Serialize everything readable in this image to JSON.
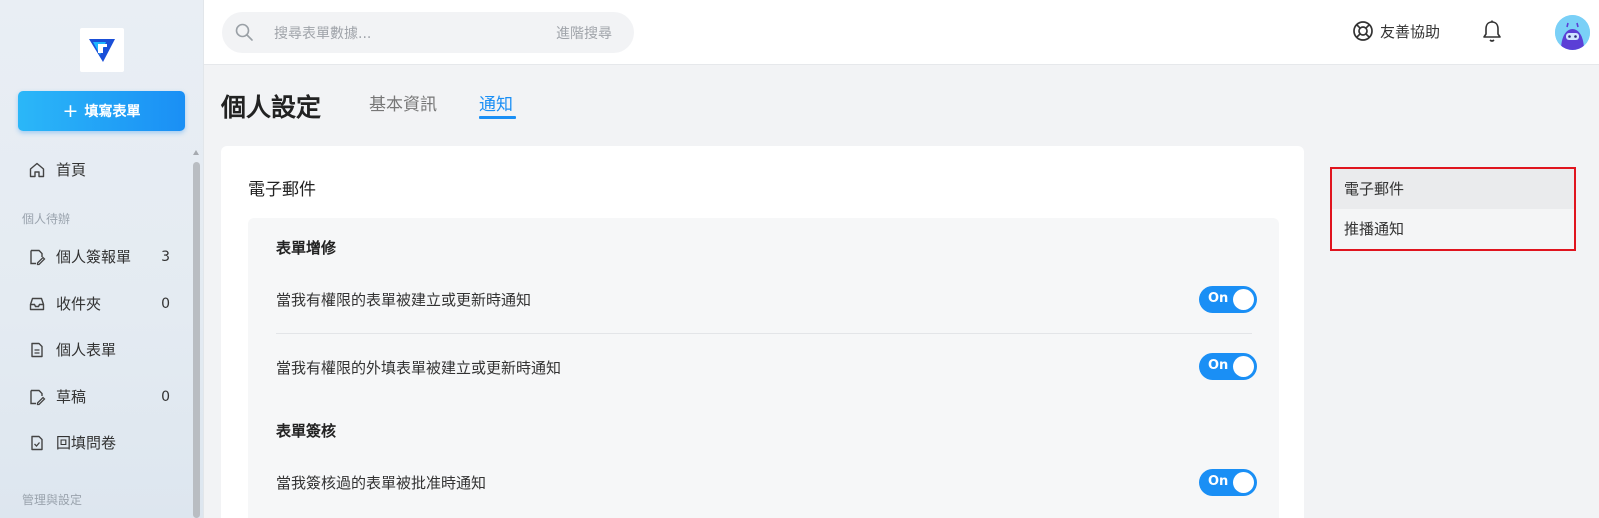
{
  "sidebar": {
    "fill_button": "填寫表單",
    "home": "首頁",
    "section_personal": "個人待辦",
    "items": [
      {
        "label": "個人簽報單",
        "count": "3"
      },
      {
        "label": "收件夾",
        "count": "0"
      },
      {
        "label": "個人表單",
        "count": ""
      },
      {
        "label": "草稿",
        "count": "0"
      },
      {
        "label": "回填問卷",
        "count": ""
      }
    ],
    "section_admin": "管理與設定"
  },
  "header": {
    "search_placeholder": "搜尋表單數據...",
    "advanced_search": "進階搜尋",
    "help": "友善協助"
  },
  "page": {
    "title": "個人設定",
    "tabs": [
      "基本資訊",
      "通知"
    ],
    "active_tab": "通知"
  },
  "email_card": {
    "title": "電子郵件",
    "groups": [
      {
        "title": "表單增修",
        "rows": [
          {
            "text": "當我有權限的表單被建立或更新時通知",
            "toggle": "On"
          },
          {
            "text": "當我有權限的外填表單被建立或更新時通知",
            "toggle": "On"
          }
        ]
      },
      {
        "title": "表單簽核",
        "rows": [
          {
            "text": "當我簽核過的表單被批准時通知",
            "toggle": "On"
          }
        ]
      }
    ]
  },
  "anchor_nav": {
    "items": [
      "電子郵件",
      "推播通知"
    ]
  },
  "colors": {
    "accent": "#1a8ff5",
    "highlight_border": "#e0141e"
  }
}
